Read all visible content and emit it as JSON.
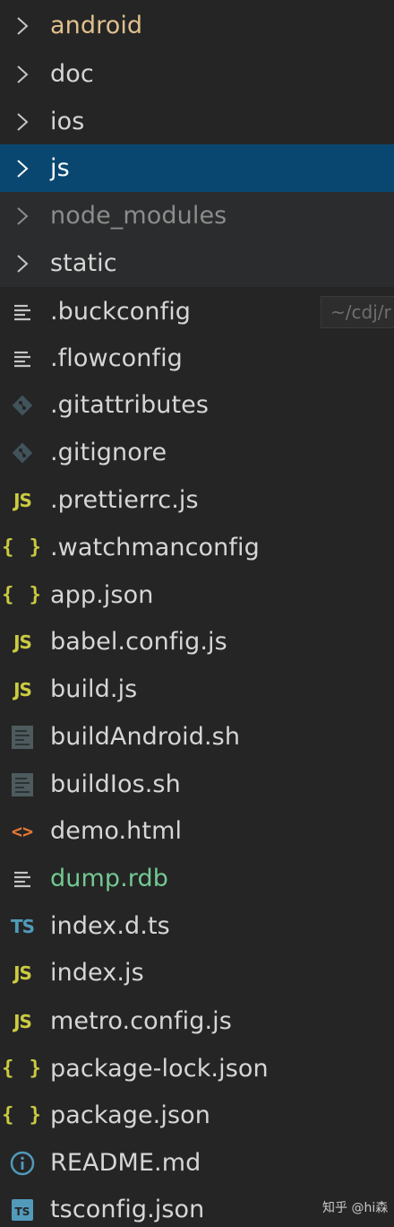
{
  "explorer": {
    "folders": [
      {
        "label": "android"
      },
      {
        "label": "doc"
      },
      {
        "label": "ios"
      },
      {
        "label": "js"
      },
      {
        "label": "node_modules"
      },
      {
        "label": "static"
      }
    ],
    "files": [
      {
        "label": ".buckconfig",
        "icon": "lines-icon"
      },
      {
        "label": ".flowconfig",
        "icon": "lines-icon"
      },
      {
        "label": ".gitattributes",
        "icon": "git-icon"
      },
      {
        "label": ".gitignore",
        "icon": "git-icon"
      },
      {
        "label": ".prettierrc.js",
        "icon": "js-icon"
      },
      {
        "label": ".watchmanconfig",
        "icon": "json-icon"
      },
      {
        "label": "app.json",
        "icon": "json-icon"
      },
      {
        "label": "babel.config.js",
        "icon": "js-icon"
      },
      {
        "label": "build.js",
        "icon": "js-icon"
      },
      {
        "label": "buildAndroid.sh",
        "icon": "shell-icon"
      },
      {
        "label": "buildIos.sh",
        "icon": "shell-icon"
      },
      {
        "label": "demo.html",
        "icon": "html-icon"
      },
      {
        "label": "dump.rdb",
        "icon": "lines-icon"
      },
      {
        "label": "index.d.ts",
        "icon": "ts-icon"
      },
      {
        "label": "index.js",
        "icon": "js-icon"
      },
      {
        "label": "metro.config.js",
        "icon": "js-icon"
      },
      {
        "label": "package-lock.json",
        "icon": "json-icon"
      },
      {
        "label": "package.json",
        "icon": "json-icon"
      },
      {
        "label": "README.md",
        "icon": "info-icon"
      },
      {
        "label": "tsconfig.json",
        "icon": "tsconfig-icon"
      }
    ],
    "icon_glyphs": {
      "js": "JS",
      "ts": "TS",
      "json": "{ }",
      "html": "<>"
    }
  },
  "tooltip": {
    "text": "~/cdj/r"
  },
  "watermark": {
    "text": "知乎 @hi森"
  },
  "colors": {
    "background": "#252526",
    "selected": "#094771",
    "android_label": "#e2c08d",
    "untracked_label": "#73c991",
    "dimmed_label": "#8c8c8c",
    "js_icon": "#cbcb41",
    "ts_icon": "#519aba",
    "html_icon": "#e37933"
  }
}
